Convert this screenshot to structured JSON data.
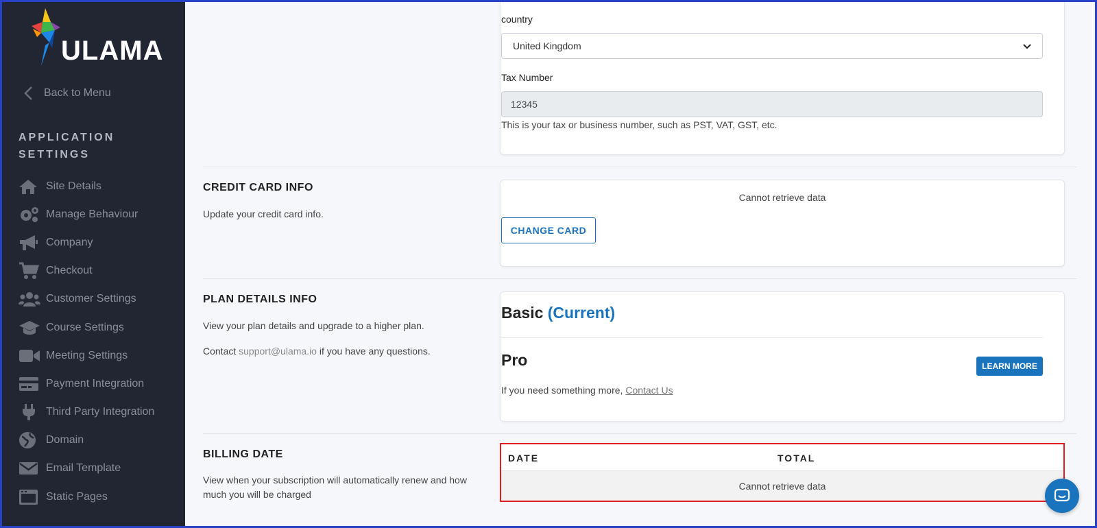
{
  "brand": {
    "logo_text": "ULAMA"
  },
  "sidebar": {
    "back_label": "Back to Menu",
    "section_title": "APPLICATION SETTINGS",
    "items": [
      {
        "label": "Site Details",
        "icon": "home-icon"
      },
      {
        "label": "Manage Behaviour",
        "icon": "gears-icon"
      },
      {
        "label": "Company",
        "icon": "megaphone-icon"
      },
      {
        "label": "Checkout",
        "icon": "cart-icon"
      },
      {
        "label": "Customer Settings",
        "icon": "users-icon"
      },
      {
        "label": "Course Settings",
        "icon": "graduation-cap-icon"
      },
      {
        "label": "Meeting Settings",
        "icon": "video-icon"
      },
      {
        "label": "Payment Integration",
        "icon": "credit-card-icon"
      },
      {
        "label": "Third Party Integration",
        "icon": "plug-icon"
      },
      {
        "label": "Domain",
        "icon": "globe-icon"
      },
      {
        "label": "Email Template",
        "icon": "envelope-icon"
      },
      {
        "label": "Static Pages",
        "icon": "window-icon"
      }
    ]
  },
  "address": {
    "country_label": "country",
    "country_value": "United Kingdom",
    "tax_label": "Tax Number",
    "tax_value": "12345",
    "tax_help": "This is your tax or business number, such as PST, VAT, GST, etc."
  },
  "credit_card": {
    "title": "CREDIT CARD INFO",
    "description": "Update your credit card info.",
    "status": "Cannot retrieve data",
    "button": "CHANGE CARD"
  },
  "plan": {
    "title": "PLAN DETAILS INFO",
    "description": "View your plan details and upgrade to a higher plan.",
    "contact_prefix": "Contact",
    "contact_email": "support@ulama.io",
    "contact_suffix": "if you have any questions.",
    "basic_name": "Basic",
    "basic_current": "(Current)",
    "pro_name": "Pro",
    "learn_more": "LEARN MORE",
    "more_prefix": "If you need something more,",
    "more_link": "Contact Us"
  },
  "billing": {
    "title": "BILLING DATE",
    "description": "View when your subscription will automatically renew and how much you will be charged",
    "col_date": "DATE",
    "col_total": "TOTAL",
    "empty": "Cannot retrieve data"
  },
  "colors": {
    "sidebar_bg": "#222632",
    "accent": "#1a73bd",
    "highlight_border": "#e01e1e"
  }
}
